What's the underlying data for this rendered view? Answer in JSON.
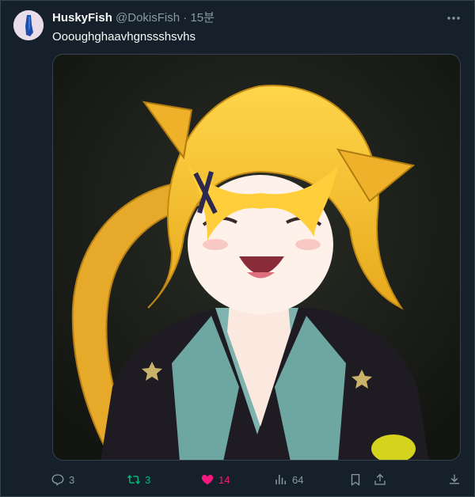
{
  "tweet": {
    "author_name": "HuskyFish",
    "handle": "@DokisFish",
    "separator": "·",
    "time": "15분",
    "text": "Oooughghaavhgnssshsvhs"
  },
  "actions": {
    "reply_count": "3",
    "retweet_count": "3",
    "like_count": "14",
    "views_count": "64"
  },
  "colors": {
    "background": "#15202b",
    "retweet_active": "#00ba7c",
    "like_active": "#f91880",
    "muted": "#8b98a5"
  },
  "icons": [
    "more-icon",
    "reply-icon",
    "retweet-icon",
    "like-icon",
    "views-icon",
    "bookmark-icon",
    "share-icon",
    "download-icon"
  ]
}
